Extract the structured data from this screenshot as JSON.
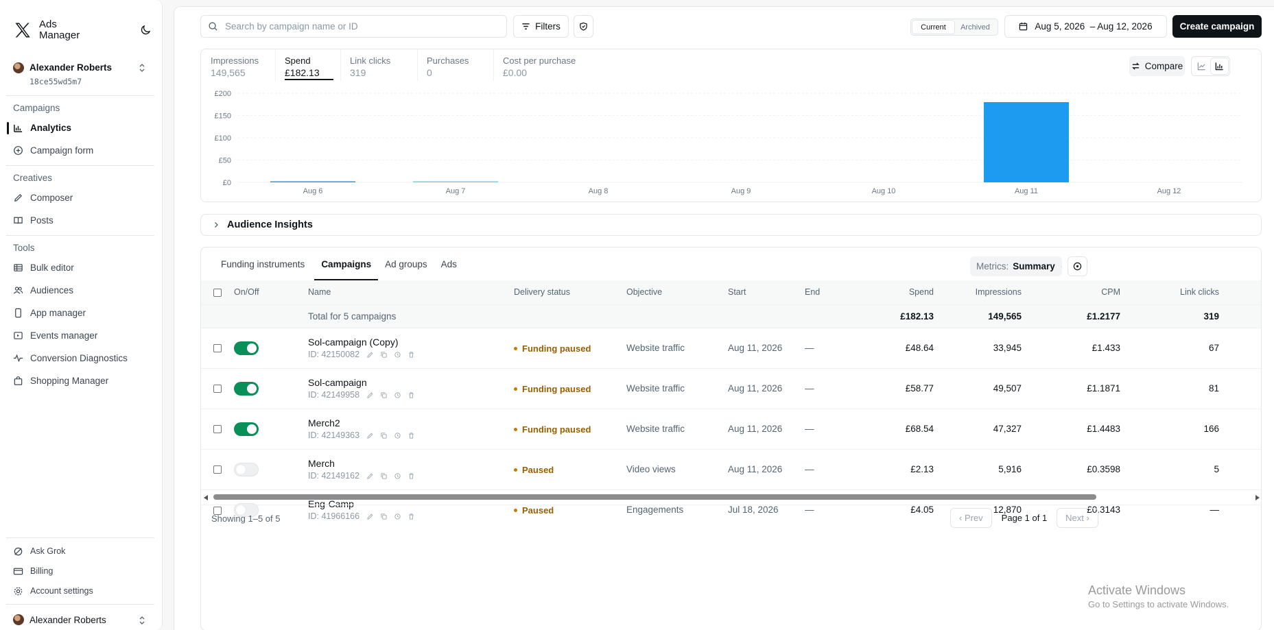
{
  "sidebar": {
    "brand": "Ads Manager",
    "account_name": "Alexander Roberts",
    "account_id": "18ce55wd5m7",
    "sections": {
      "campaigns": "Campaigns",
      "creatives": "Creatives",
      "tools": "Tools"
    },
    "items": {
      "analytics": "Analytics",
      "campaign_form": "Campaign form",
      "composer": "Composer",
      "posts": "Posts",
      "bulk_editor": "Bulk editor",
      "audiences": "Audiences",
      "app_manager": "App manager",
      "events_manager": "Events manager",
      "conversion_diagnostics": "Conversion Diagnostics",
      "shopping_manager": "Shopping Manager",
      "ask_grok": "Ask Grok",
      "billing": "Billing",
      "account_settings": "Account settings"
    },
    "bottom_account_name": "Alexander Roberts"
  },
  "toolbar": {
    "search_placeholder": "Search by campaign name or ID",
    "filters_label": "Filters",
    "segment_current": "Current",
    "segment_archived": "Archived",
    "date_range": "Aug 5, 2026  – Aug 12, 2026",
    "create_label": "Create campaign"
  },
  "metrics": [
    {
      "label": "Impressions",
      "value": "149,565"
    },
    {
      "label": "Spend",
      "value": "£182.13"
    },
    {
      "label": "Link clicks",
      "value": "319"
    },
    {
      "label": "Purchases",
      "value": "0"
    },
    {
      "label": "Cost per purchase",
      "value": "£0.00"
    }
  ],
  "compare_label": "Compare",
  "chart_data": {
    "type": "bar",
    "categories": [
      "Aug 6",
      "Aug 7",
      "Aug 8",
      "Aug 9",
      "Aug 10",
      "Aug 11",
      "Aug 12"
    ],
    "values": [
      1.6,
      0.6,
      0,
      0,
      0,
      180.0,
      0
    ],
    "title": "",
    "xlabel": "",
    "ylabel": "",
    "ylim": [
      0,
      200
    ],
    "yticks": [
      "£200",
      "£150",
      "£100",
      "£50",
      "£0"
    ],
    "ytick_values": [
      200,
      150,
      100,
      50,
      0
    ],
    "bar_color": "#1d9bf0",
    "grid": true
  },
  "audience_insights": "Audience Insights",
  "tabs": [
    "Funding instruments",
    "Campaigns",
    "Ad groups",
    "Ads"
  ],
  "metrics_select": {
    "label": "Metrics:",
    "value": "Summary"
  },
  "table": {
    "headers": {
      "onoff": "On/Off",
      "name": "Name",
      "delivery": "Delivery status",
      "objective": "Objective",
      "start": "Start",
      "end": "End",
      "spend": "Spend",
      "impressions": "Impressions",
      "cpm": "CPM",
      "clicks": "Link clicks"
    },
    "total": {
      "label": "Total for 5 campaigns",
      "spend": "£182.13",
      "impressions": "149,565",
      "cpm": "£1.2177",
      "clicks": "319"
    },
    "rows": [
      {
        "name": "Sol-campaign (Copy)",
        "id": "ID: 42150082",
        "on": true,
        "status": "Funding paused",
        "objective": "Website traffic",
        "start": "Aug 11, 2026",
        "end": "—",
        "spend": "£48.64",
        "impressions": "33,945",
        "cpm": "£1.433",
        "clicks": "67"
      },
      {
        "name": "Sol-campaign",
        "id": "ID: 42149958",
        "on": true,
        "status": "Funding paused",
        "objective": "Website traffic",
        "start": "Aug 11, 2026",
        "end": "—",
        "spend": "£58.77",
        "impressions": "49,507",
        "cpm": "£1.1871",
        "clicks": "81"
      },
      {
        "name": "Merch2",
        "id": "ID: 42149363",
        "on": true,
        "status": "Funding paused",
        "objective": "Website traffic",
        "start": "Aug 11, 2026",
        "end": "—",
        "spend": "£68.54",
        "impressions": "47,327",
        "cpm": "£1.4483",
        "clicks": "166"
      },
      {
        "name": "Merch",
        "id": "ID: 42149162",
        "on": false,
        "status": "Paused",
        "objective": "Video views",
        "start": "Aug 11, 2026",
        "end": "—",
        "spend": "£2.13",
        "impressions": "5,916",
        "cpm": "£0.3598",
        "clicks": "5"
      },
      {
        "name": "Eng-Camp",
        "id": "ID: 41966166",
        "on": false,
        "status": "Paused",
        "objective": "Engagements",
        "start": "Jul 18, 2026",
        "end": "—",
        "spend": "£4.05",
        "impressions": "12,870",
        "cpm": "£0.3143",
        "clicks": "—"
      }
    ]
  },
  "footer": {
    "showing": "Showing 1–5 of 5",
    "prev": "‹ Prev",
    "page": "Page 1 of 1",
    "next": "Next ›"
  },
  "watermark": {
    "line1": "Activate Windows",
    "line2": "Go to Settings to activate Windows."
  }
}
